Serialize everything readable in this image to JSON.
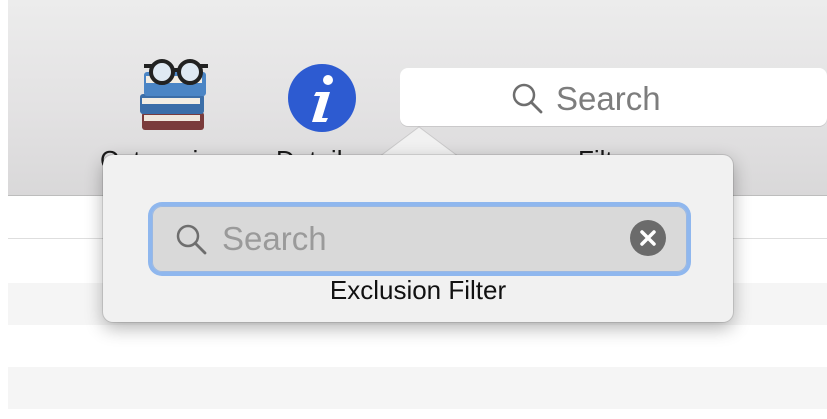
{
  "toolbar": {
    "items": [
      {
        "label": "Categories",
        "icon": "books-with-glasses-icon"
      },
      {
        "label": "Details",
        "icon": "info-icon"
      },
      {
        "label": "Filter",
        "icon": "search-icon"
      }
    ],
    "search": {
      "placeholder": "Search"
    }
  },
  "popover": {
    "search": {
      "placeholder": "Search",
      "value": ""
    },
    "label": "Exclusion Filter"
  },
  "colors": {
    "info_icon": "#2d5bd1",
    "focus_ring": "#8fb7ee",
    "toolbar_bg": "#e3e2e3",
    "stripe": "#f5f5f5"
  }
}
